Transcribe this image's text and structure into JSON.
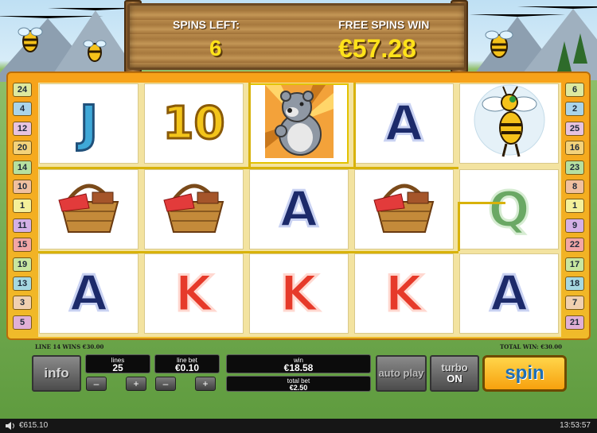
{
  "header": {
    "spins_left_label": "SPINS LEFT:",
    "spins_left_value": "6",
    "free_spins_win_label": "FREE SPINS WIN",
    "free_spins_win_value": "€57.28"
  },
  "reels": [
    [
      {
        "symbol": "J",
        "icon": "letter-j-symbol"
      },
      {
        "symbol": "picnic-basket",
        "icon": "picnic-basket-symbol"
      },
      {
        "symbol": "A",
        "icon": "letter-a-symbol"
      }
    ],
    [
      {
        "symbol": "10",
        "icon": "number-10-symbol"
      },
      {
        "symbol": "picnic-basket",
        "icon": "picnic-basket-symbol"
      },
      {
        "symbol": "K",
        "icon": "letter-k-symbol"
      }
    ],
    [
      {
        "symbol": "bear",
        "icon": "bear-wild-symbol"
      },
      {
        "symbol": "A",
        "icon": "letter-a-symbol"
      },
      {
        "symbol": "K",
        "icon": "letter-k-symbol"
      }
    ],
    [
      {
        "symbol": "A",
        "icon": "letter-a-symbol"
      },
      {
        "symbol": "picnic-basket",
        "icon": "picnic-basket-symbol"
      },
      {
        "symbol": "K",
        "icon": "letter-k-symbol"
      }
    ],
    [
      {
        "symbol": "bee",
        "icon": "bee-symbol"
      },
      {
        "symbol": "Q",
        "icon": "letter-q-symbol"
      },
      {
        "symbol": "A",
        "icon": "letter-a-symbol"
      }
    ]
  ],
  "paylines_left": [
    "24",
    "4",
    "12",
    "20",
    "14",
    "10",
    "1",
    "11",
    "15",
    "19",
    "13",
    "3",
    "5"
  ],
  "paylines_right": [
    "6",
    "2",
    "25",
    "16",
    "23",
    "8",
    "1",
    "9",
    "22",
    "17",
    "18",
    "7",
    "21"
  ],
  "info_strip": {
    "line_win": "LINE 14 WINS €30.00",
    "total_win": "TOTAL WIN: €30.00"
  },
  "controls": {
    "info_label": "info",
    "lines_label": "lines",
    "lines_value": "25",
    "line_bet_label": "line bet",
    "line_bet_value": "€0.10",
    "minus": "–",
    "plus": "+",
    "win_label": "win",
    "win_value": "€18.58",
    "total_bet_label": "total bet",
    "total_bet_value": "€2.50",
    "autoplay_label": "auto play",
    "turbo_label": "turbo",
    "turbo_state": "ON",
    "spin_label": "spin"
  },
  "status_bar": {
    "balance": "€615.10",
    "clock": "13:53:57"
  },
  "colors": {
    "frame_orange": "#f7a21a",
    "sign_text_yellow": "#ffe21a",
    "winline_gold": "#d8b20a",
    "spin_blue": "#1f6fb5"
  }
}
